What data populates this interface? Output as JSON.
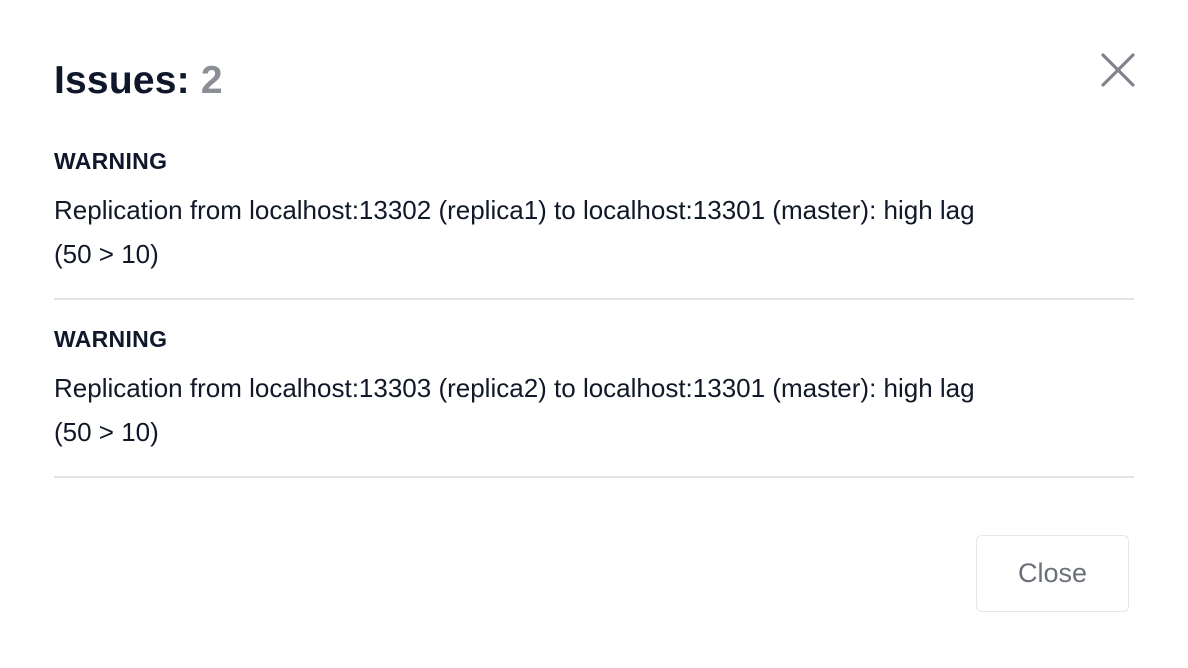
{
  "dialog": {
    "title_label": "Issues:",
    "issue_count": "2",
    "close_icon": "close-icon",
    "close_button_label": "Close"
  },
  "issues": [
    {
      "level": "WARNING",
      "message_line1": "Replication from localhost:13302 (replica1) to localhost:13301 (master): high lag",
      "message_line2": "(50 > 10)"
    },
    {
      "level": "WARNING",
      "message_line1": "Replication from localhost:13303 (replica2) to localhost:13301 (master): high lag",
      "message_line2": "(50 > 10)"
    }
  ],
  "colors": {
    "title": "#0f172a",
    "count": "#8b8e97",
    "divider": "#e2e2e6",
    "close_icon": "#80838b"
  }
}
